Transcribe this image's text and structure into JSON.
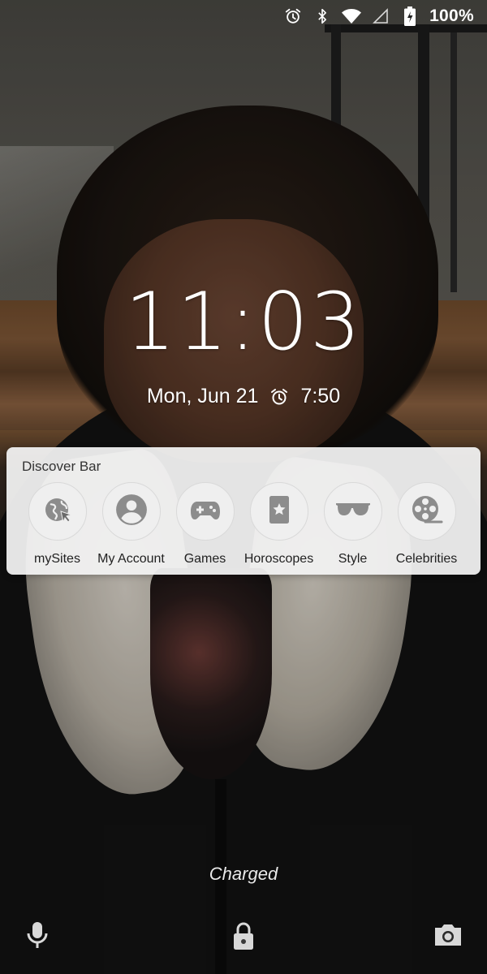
{
  "status_bar": {
    "battery_percent": "100%",
    "icons": [
      "alarm-icon",
      "bluetooth-icon",
      "wifi-icon",
      "cellular-signal-icon",
      "battery-charging-icon"
    ]
  },
  "lockscreen": {
    "time": "11:03",
    "date": "Mon, Jun 21",
    "alarm_time": "7:50"
  },
  "discover_bar": {
    "title": "Discover Bar",
    "items": [
      {
        "label": "mySites",
        "icon": "globe-cursor-icon"
      },
      {
        "label": "My Account",
        "icon": "account-circle-icon"
      },
      {
        "label": "Games",
        "icon": "gamepad-icon"
      },
      {
        "label": "Horoscopes",
        "icon": "star-card-icon"
      },
      {
        "label": "Style",
        "icon": "sunglasses-icon"
      },
      {
        "label": "Celebrities",
        "icon": "film-reel-icon"
      }
    ]
  },
  "charging_status": "Charged",
  "bottom_actions": {
    "left": "microphone-icon",
    "center": "lock-icon",
    "right": "camera-icon"
  }
}
